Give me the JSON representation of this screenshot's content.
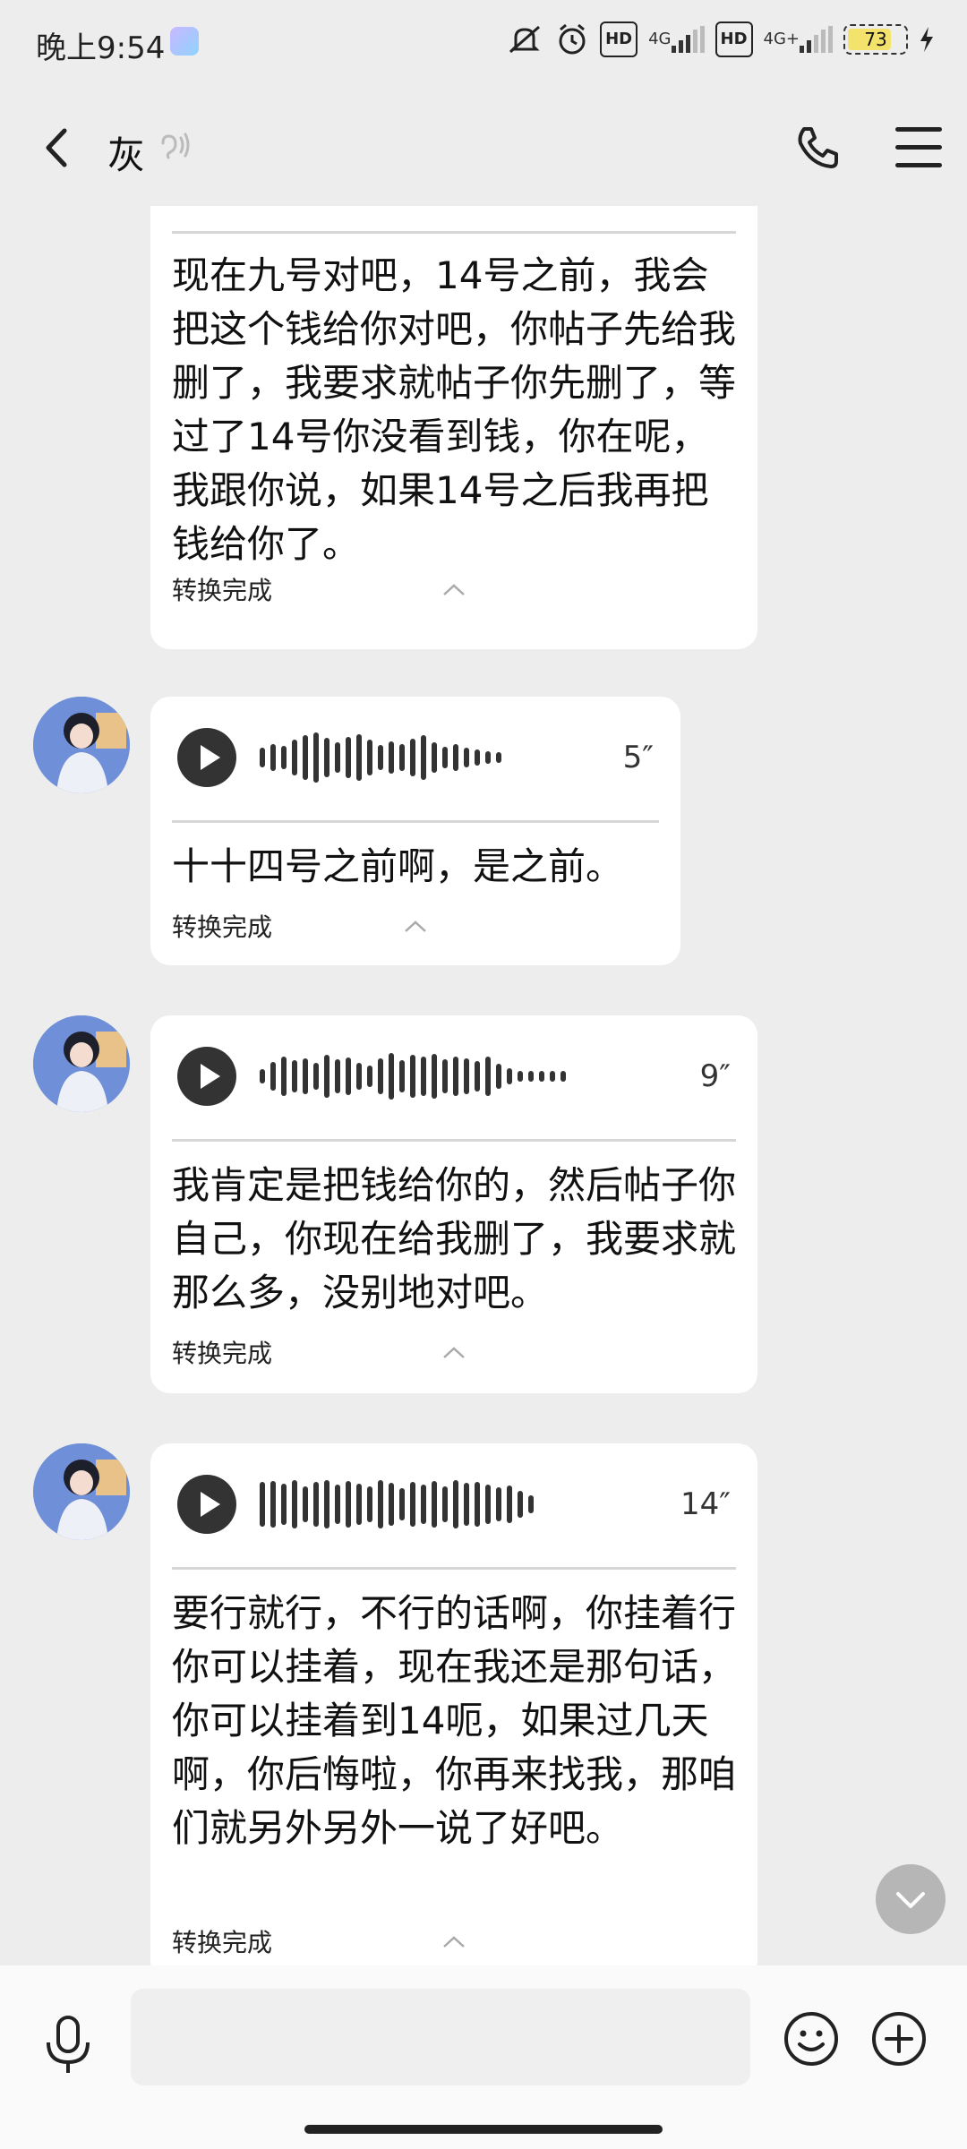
{
  "status_bar": {
    "time": "晚上9:54",
    "network_1": "4G",
    "network_2": "4G+",
    "hd_1": "HD",
    "hd_2": "HD",
    "battery": "73"
  },
  "header": {
    "title": "灰"
  },
  "messages": [
    {
      "type": "voice",
      "partial": true,
      "transcript": "现在九号对吧，14号之前，我会把这个钱给你对吧，你帖子先给我删了，我要求就帖子你先删了，等过了14号你没看到钱，你在呢，我跟你说，如果14号之后我再把钱给你了。",
      "status": "转换完成"
    },
    {
      "type": "voice",
      "duration": "5″",
      "transcript": "十十四号之前啊，是之前。",
      "status": "转换完成"
    },
    {
      "type": "voice",
      "duration": "9″",
      "transcript": "我肯定是把钱给你的，然后帖子你自己，你现在给我删了，我要求就那么多，没别地对吧。",
      "status": "转换完成"
    },
    {
      "type": "voice",
      "duration": "14″",
      "transcript": "要行就行，不行的话啊，你挂着行你可以挂着，现在我还是那句话，你可以挂着到14呃，如果过几天啊，你后悔啦，你再来找我，那咱们就另外另外一说了好吧。",
      "status": "转换完成"
    }
  ],
  "input": {
    "value": "",
    "placeholder": ""
  },
  "icons": {
    "back": "chevron-left-icon",
    "ear": "ear-icon",
    "phone": "phone-icon",
    "menu": "menu-icon",
    "mic": "microphone-icon",
    "emoji": "smiley-icon",
    "plus": "plus-circle-icon",
    "scroll": "chevron-down-icon"
  }
}
